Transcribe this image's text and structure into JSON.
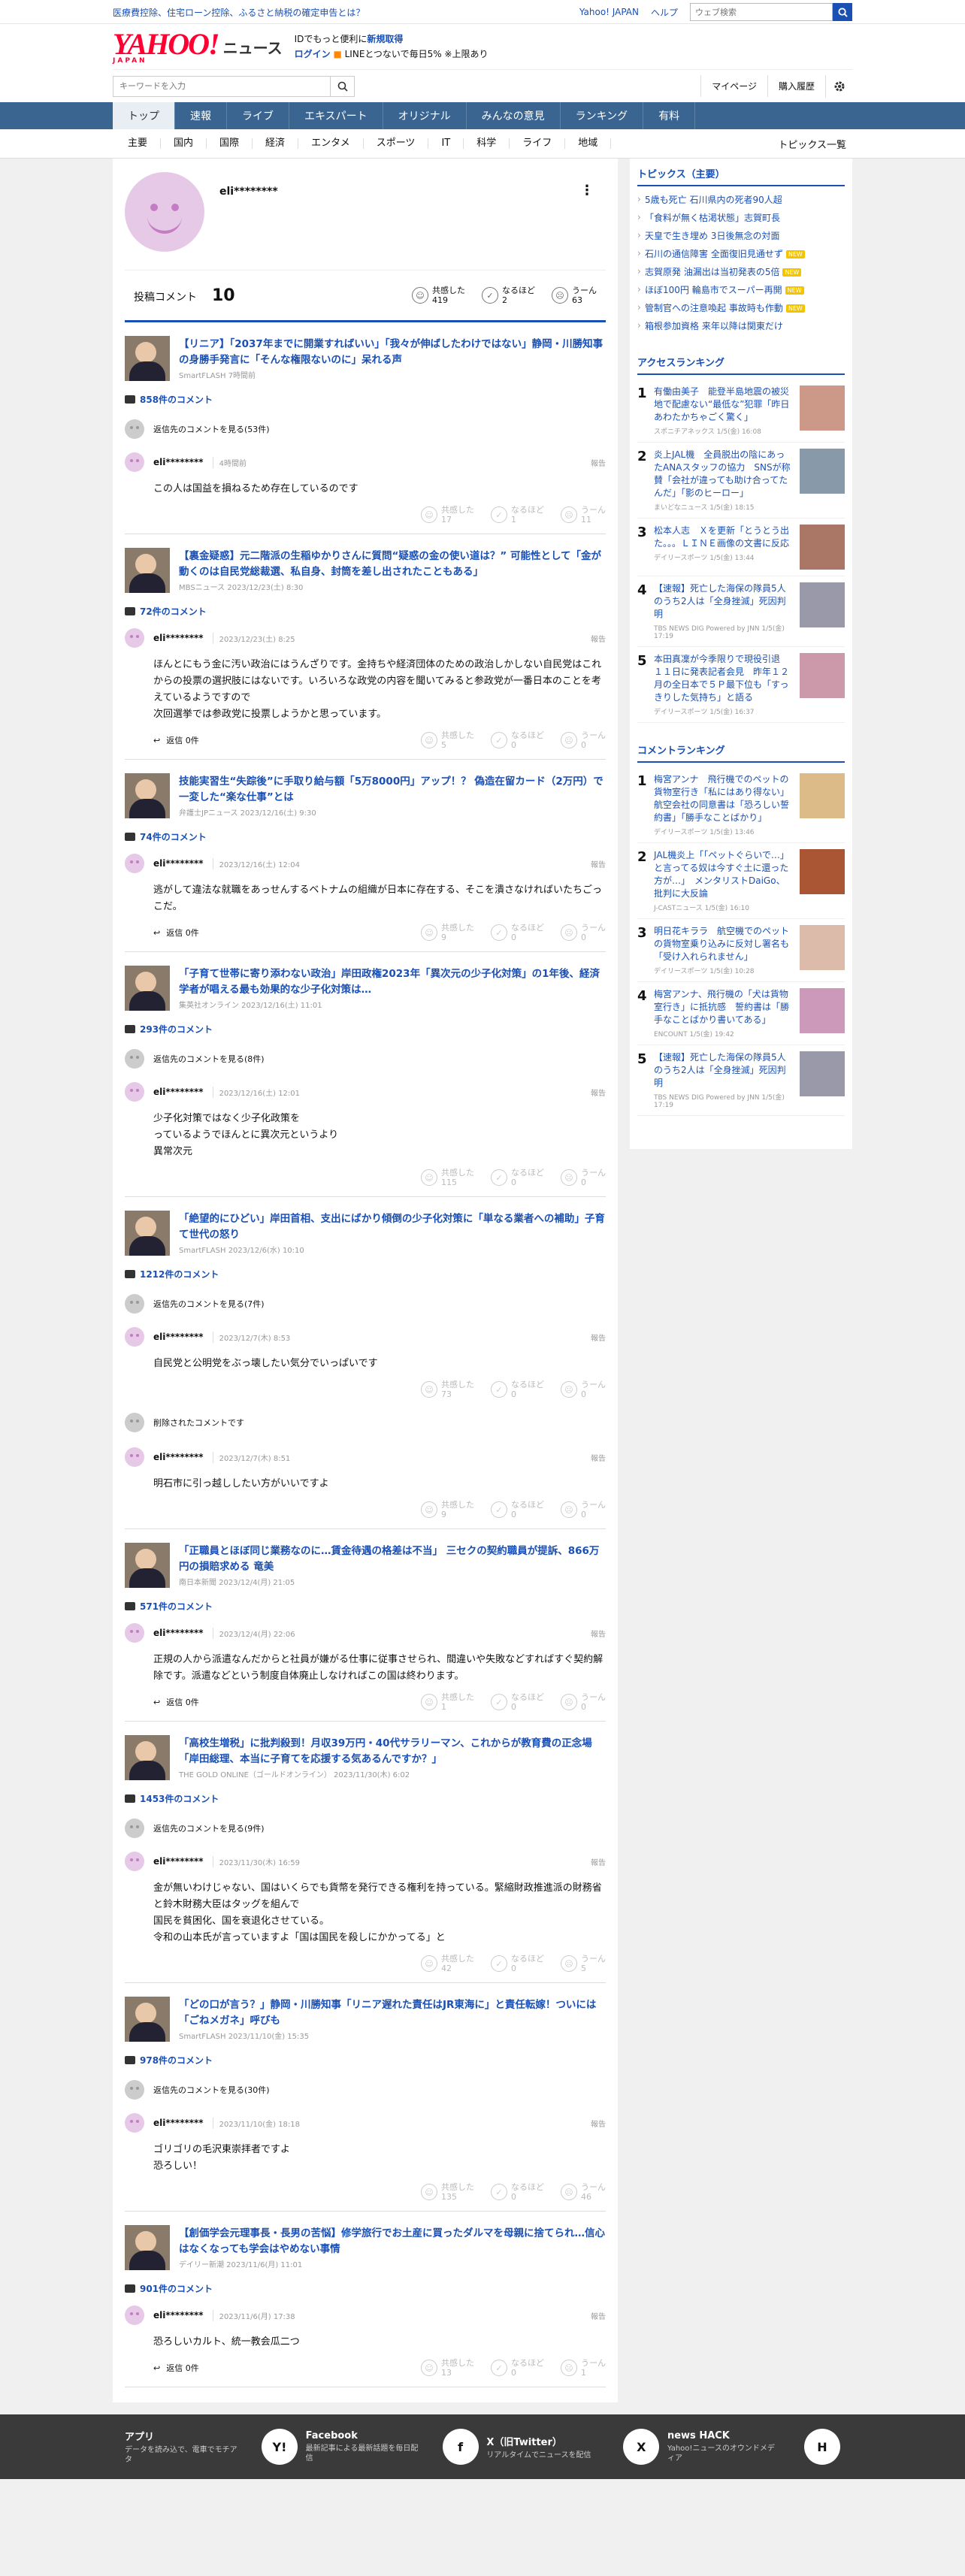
{
  "topbar": {
    "notice": "医療費控除、住宅ローン控除、ふるさと納税の確定申告とは？",
    "links": [
      "Yahoo! JAPAN",
      "ヘルプ"
    ],
    "search_placeholder": "ウェブ検索"
  },
  "header": {
    "logo_main": "YAHOO!",
    "logo_sub": "JAPAN",
    "logo_news": "ニュース",
    "promo_line1a": "IDでもっと便利に",
    "promo_line1b": "新規取得",
    "promo_login": "ログイン",
    "promo_line2": "LINEとつないで毎日5% ※上限あり"
  },
  "search": {
    "placeholder": "キーワードを入力",
    "mypage": "マイページ",
    "history": "購入履歴"
  },
  "mainnav": [
    "トップ",
    "速報",
    "ライブ",
    "エキスパート",
    "オリジナル",
    "みんなの意見",
    "ランキング",
    "有料"
  ],
  "subnav": {
    "items": [
      "主要",
      "国内",
      "国際",
      "経済",
      "エンタメ",
      "スポーツ",
      "IT",
      "科学",
      "ライフ",
      "地域"
    ],
    "all": "トピックス一覧"
  },
  "profile": {
    "name": "eli********",
    "posted_label": "投稿コメント",
    "posted_count": "10",
    "reactions": [
      {
        "label": "共感した",
        "count": "419"
      },
      {
        "label": "なるほど",
        "count": "2"
      },
      {
        "label": "うーん",
        "count": "63"
      }
    ]
  },
  "labels": {
    "report": "報告",
    "reply": "返信",
    "empathy": "共感した",
    "naruhodo": "なるほど",
    "uun": "うーん",
    "deleted": "削除されたコメントです"
  },
  "articles": [
    {
      "title": "【リニア】「2037年までに開業すればいい」「我々が伸ばしたわけではない」静岡・川勝知事の身勝手発言に「そんな権限ないのに」呆れる声",
      "source": "SmartFLASH 7時間前",
      "comment_count": "858件のコメント",
      "reply_text": "返信先のコメントを見る(53件)",
      "comments": [
        {
          "user": "eli********",
          "time": "4時間前",
          "body": "この人は国益を損ねるため存在しているのです",
          "reply": "",
          "r": [
            "17",
            "1",
            "11"
          ]
        }
      ]
    },
    {
      "title": "【裏金疑惑】元二階派の生稲ゆかりさんに質問“疑惑の金の使い道は？” 可能性として「金が動くのは自民党総裁選、私自身、封筒を差し出されたこともある」",
      "source": "MBSニュース 2023/12/23(土) 8:30",
      "comment_count": "72件のコメント",
      "reply_text": "",
      "comments": [
        {
          "user": "eli********",
          "time": "2023/12/23(土) 8:25",
          "body": "ほんとにもう金に汚い政治にはうんざりです。金持ちや経済団体のための政治しかしない自民党はこれからの投票の選択肢にはないです。いろいろな政党の内容を聞いてみると参政党が一番日本のことを考えているようですので\n次回選挙では参政党に投票しようかと思っています。",
          "reply": "返信 0件",
          "r": [
            "5",
            "0",
            "0"
          ]
        }
      ]
    },
    {
      "title": "技能実習生“失踪後”に手取り給与額「5万8000円」アップ！？ 偽造在留カード（2万円）で一変した“楽な仕事”とは",
      "source": "弁護士JPニュース 2023/12/16(土) 9:30",
      "comment_count": "74件のコメント",
      "reply_text": "",
      "comments": [
        {
          "user": "eli********",
          "time": "2023/12/16(土) 12:04",
          "body": "逃がして違法な就職をあっせんするベトナムの組織が日本に存在する、そこを潰さなければいたちごっこだ。",
          "reply": "返信 0件",
          "r": [
            "9",
            "0",
            "0"
          ]
        }
      ]
    },
    {
      "title": "「子育て世帯に寄り添わない政治」岸田政権2023年「異次元の少子化対策」の1年後、経済学者が唱える最も効果的な少子化対策は…",
      "source": "集英社オンライン 2023/12/16(土) 11:01",
      "comment_count": "293件のコメント",
      "reply_text": "返信先のコメントを見る(8件)",
      "comments": [
        {
          "user": "eli********",
          "time": "2023/12/16(土) 12:01",
          "body": "少子化対策ではなく少子化政策を\nっているようでほんとに異次元というより\n異常次元",
          "reply": "",
          "r": [
            "115",
            "0",
            "0"
          ]
        }
      ]
    },
    {
      "title": "「絶望的にひどい」岸田首相、支出にばかり傾倒の少子化対策に「単なる業者への補助」子育て世代の怒り",
      "source": "SmartFLASH 2023/12/6(水) 10:10",
      "comment_count": "1212件のコメント",
      "reply_text": "返信先のコメントを見る(7件)",
      "comments": [
        {
          "user": "eli********",
          "time": "2023/12/7(木) 8:53",
          "body": "自民党と公明党をぶっ壊したい気分でいっぱいです",
          "reply": "",
          "r": [
            "73",
            "0",
            "0"
          ]
        },
        {
          "user": "eli********",
          "time": "2023/12/7(木) 8:51",
          "body": "明石市に引っ越ししたい方がいいですよ",
          "reply": "",
          "r": [
            "9",
            "0",
            "0"
          ],
          "deleted_before": true
        }
      ]
    },
    {
      "title": "「正職員とほぼ同じ業務なのに…賃金待遇の格差は不当」 三セクの契約職員が提訴、866万円の損賠求める 竜美",
      "source": "南日本新聞 2023/12/4(月) 21:05",
      "comment_count": "571件のコメント",
      "reply_text": "",
      "comments": [
        {
          "user": "eli********",
          "time": "2023/12/4(月) 22:06",
          "body": "正規の人から派遣なんだからと社員が嫌がる仕事に従事させられ、間違いや失敗などすればすぐ契約解除です。派遣などという制度自体廃止しなければこの国は終わります。",
          "reply": "返信 0件",
          "r": [
            "1",
            "0",
            "0"
          ]
        }
      ]
    },
    {
      "title": "「高校生増税」に批判殺到！月収39万円・40代サラリーマン、これからが教育費の正念場「岸田総理、本当に子育てを応援する気あるんですか？」",
      "source": "THE GOLD ONLINE（ゴールドオンライン） 2023/11/30(木) 6:02",
      "comment_count": "1453件のコメント",
      "reply_text": "返信先のコメントを見る(9件)",
      "comments": [
        {
          "user": "eli********",
          "time": "2023/11/30(木) 16:59",
          "body": "金が無いわけじゃない、国はいくらでも貨幣を発行できる権利を持っている。緊縮財政推進派の財務省と鈴木財務大臣はタッグを組んで\n国民を貧困化、国を衰退化させている。\n令和の山本氏が言っていますよ「国は国民を殺しにかかってる」と",
          "reply": "",
          "r": [
            "42",
            "0",
            "5"
          ]
        }
      ]
    },
    {
      "title": "「どの口が言う？」静岡・川勝知事「リニア遅れた責任はJR東海に」と責任転嫁！ついには「ごねメガネ」呼びも",
      "source": "SmartFLASH 2023/11/10(金) 15:35",
      "comment_count": "978件のコメント",
      "reply_text": "返信先のコメントを見る(30件)",
      "comments": [
        {
          "user": "eli********",
          "time": "2023/11/10(金) 18:18",
          "body": "ゴリゴリの毛沢東崇拝者ですよ\n恐ろしい！",
          "reply": "",
          "r": [
            "135",
            "0",
            "46"
          ]
        }
      ]
    },
    {
      "title": "【創価学会元理事長・長男の苦悩】修学旅行でお土産に買ったダルマを母親に捨てられ…信心はなくなっても学会はやめない事情",
      "source": "デイリー新潮 2023/11/6(月) 11:01",
      "comment_count": "901件のコメント",
      "reply_text": "",
      "comments": [
        {
          "user": "eli********",
          "time": "2023/11/6(月) 17:38",
          "body": "恐ろしいカルト、統一教会瓜二つ",
          "reply": "返信 0件",
          "r": [
            "13",
            "0",
            "1"
          ]
        }
      ]
    }
  ],
  "sidebar": {
    "topics_title": "トピックス（主要）",
    "topics": [
      {
        "t": "5歳も死亡 石川県内の死者90人超",
        "new": false
      },
      {
        "t": "「食料が無く枯渇状態」志賀町長",
        "new": false
      },
      {
        "t": "天皇で生き埋め 3日後無念の対面",
        "new": false
      },
      {
        "t": "石川の通信障害 全面復旧見通せず",
        "new": true
      },
      {
        "t": "志賀原発 油漏出は当初発表の5倍",
        "new": true
      },
      {
        "t": "ほぼ100円 輪島市でスーパー再開",
        "new": true
      },
      {
        "t": "管制官への注意喚起 事故時も作動",
        "new": true
      },
      {
        "t": "箱根参加資格 来年以降は関東だけ",
        "new": false
      }
    ],
    "new_label": "NEW",
    "access_title": "アクセスランキング",
    "access": [
      {
        "n": "1",
        "t": "有働由美子　能登半島地震の被災地で配慮ない“最低な”犯罪「昨日あわたかちゃごく驚く」",
        "s": "スポニチアネックス 1/5(金) 16:08",
        "c": "#c98"
      },
      {
        "n": "2",
        "t": "炎上JAL機　全員脱出の陰にあったANAスタッフの協力　SNSが称賛「会社が違っても助け合ってたんだ」「影のヒーロー」",
        "s": "まいどなニュース 1/5(金) 18:15",
        "c": "#89a"
      },
      {
        "n": "3",
        "t": "松本人志　Ｘを更新「とうとう出た。。。ＬＩＮＥ画像の文書に反応",
        "s": "デイリースポーツ 1/5(金) 13:44",
        "c": "#a76"
      },
      {
        "n": "4",
        "t": "【速報】死亡した海保の隊員5人のうち2人は「全身挫滅」死因判明",
        "s": "TBS NEWS DIG Powered by JNN 1/5(金) 17:19",
        "c": "#99a"
      },
      {
        "n": "5",
        "t": "本田真凜が今季限りで現役引退　１１日に発表記者会見　昨年１２月の全日本で５Ｐ最下位も「すっきりした気持ち」と語る",
        "s": "デイリースポーツ 1/5(金) 16:37",
        "c": "#c9a"
      }
    ],
    "comment_title": "コメントランキング",
    "comment": [
      {
        "n": "1",
        "t": "梅宮アンナ　飛行機でのペットの貨物室行き「私にはあり得ない」航空会社の同意書は「恐ろしい誓約書」「勝手なことばかり」",
        "s": "デイリースポーツ 1/5(金) 13:46",
        "c": "#db8"
      },
      {
        "n": "2",
        "t": "JAL機炎上「「ペットぐらいで…」と言ってる奴は今すぐ土に還った方が…」　メンタリストDaiGo、批判に大反論",
        "s": "J-CASTニュース 1/5(金) 16:10",
        "c": "#a53"
      },
      {
        "n": "3",
        "t": "明日花キララ　航空機でのペットの貨物室乗り込みに反対し署名も「受け入れられません」",
        "s": "デイリースポーツ 1/5(金) 10:28",
        "c": "#dba"
      },
      {
        "n": "4",
        "t": "梅宮アンナ、飛行機の「犬は貨物室行き」に抵抗感　誓約書は「勝手なことばかり書いてある」",
        "s": "ENCOUNT 1/5(金) 19:42",
        "c": "#c9b"
      },
      {
        "n": "5",
        "t": "【速報】死亡した海保の隊員5人のうち2人は「全身挫滅」死因判明",
        "s": "TBS NEWS DIG Powered by JNN 1/5(金) 17:19",
        "c": "#99a"
      }
    ]
  },
  "footer": [
    {
      "title": "アプリ",
      "desc": "データを読み込で、電車でモチアタ",
      "icon": "Y!"
    },
    {
      "title": "Facebook",
      "desc": "最新記事による最新話題を毎日配信",
      "icon": "f"
    },
    {
      "title": "X（旧Twitter）",
      "desc": "リアルタイムでニュースを配信",
      "icon": "X"
    },
    {
      "title": "news HACK",
      "desc": "Yahoo!ニュースのオウンドメディア",
      "icon": "H"
    }
  ]
}
